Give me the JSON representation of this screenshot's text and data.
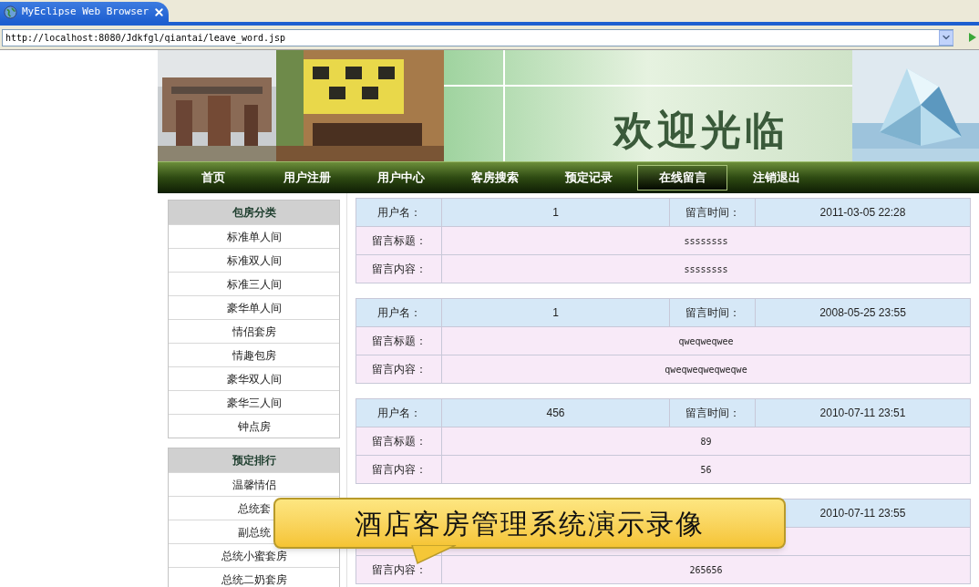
{
  "browser": {
    "tab_title": "MyEclipse Web Browser",
    "url": "http://localhost:8080/Jdkfgl/qiantai/leave_word.jsp"
  },
  "banner": {
    "welcome": "欢迎光临"
  },
  "nav": [
    {
      "label": "首页",
      "selected": false
    },
    {
      "label": "用户注册",
      "selected": false
    },
    {
      "label": "用户中心",
      "selected": false
    },
    {
      "label": "客房搜索",
      "selected": false
    },
    {
      "label": "预定记录",
      "selected": false
    },
    {
      "label": "在线留言",
      "selected": true
    },
    {
      "label": "注销退出",
      "selected": false
    }
  ],
  "sidebar": [
    {
      "title": "包房分类",
      "items": [
        "标准单人间",
        "标准双人间",
        "标准三人间",
        "豪华单人间",
        "情侣套房",
        "情趣包房",
        "豪华双人间",
        "豪华三人间",
        "钟点房"
      ]
    },
    {
      "title": "预定排行",
      "items": [
        "温馨情侣",
        "总统套",
        "副总统",
        "总统小蜜套房",
        "总统二奶套房"
      ]
    }
  ],
  "messages": [
    {
      "user_label": "用户名：",
      "user": "1",
      "time_label": "留言时间：",
      "time": "2011-03-05 22:28",
      "title_label": "留言标题：",
      "title": "ssssssss",
      "content_label": "留言内容：",
      "content": "ssssssss"
    },
    {
      "user_label": "用户名：",
      "user": "1",
      "time_label": "留言时间：",
      "time": "2008-05-25 23:55",
      "title_label": "留言标题：",
      "title": "qweqweqwee",
      "content_label": "留言内容：",
      "content": "qweqweqweqweqwe"
    },
    {
      "user_label": "用户名：",
      "user": "456",
      "time_label": "留言时间：",
      "time": "2010-07-11 23:51",
      "title_label": "留言标题：",
      "title": "89",
      "content_label": "留言内容：",
      "content": "56"
    },
    {
      "time": "2010-07-11 23:55",
      "content_label": "留言内容：",
      "content": "265656"
    }
  ],
  "callout": {
    "text": "酒店客房管理系统演示录像"
  }
}
